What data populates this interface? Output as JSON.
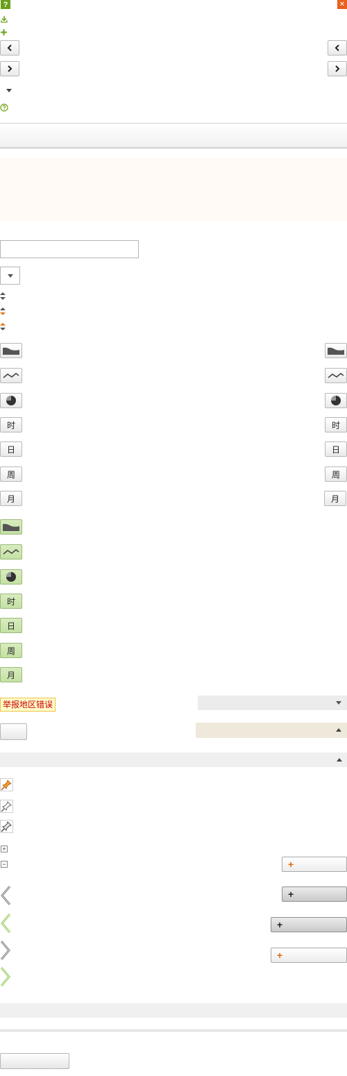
{
  "icons": {
    "help": "help-icon",
    "close": "close-icon",
    "download": "download-icon",
    "add": "plus-icon",
    "prev": "chevron-left-icon",
    "next": "chevron-right-icon",
    "dropdown": "caret-down-icon",
    "info": "circle-help-icon",
    "sort": "sort-icon",
    "area_chart": "area-chart-icon",
    "line_chart": "line-chart-icon",
    "pie_chart": "pie-chart-icon",
    "pin": "pin-icon",
    "expand": "expand-icon",
    "collapse": "collapse-icon"
  },
  "glyphs": {
    "help": "?",
    "close": "✕",
    "plus": "+",
    "minus": "−"
  },
  "time_buttons": {
    "hour": "时",
    "day": "日",
    "week": "周",
    "month": "月"
  },
  "report": {
    "label": "举报地区错误"
  },
  "colors": {
    "accent_green": "#6a9f1a",
    "close_orange": "#e8601c",
    "active_green": "#c8e3aa",
    "notice_bg": "#fffaf6",
    "report_text": "#cc0000",
    "report_bg": "#ffffcc"
  }
}
